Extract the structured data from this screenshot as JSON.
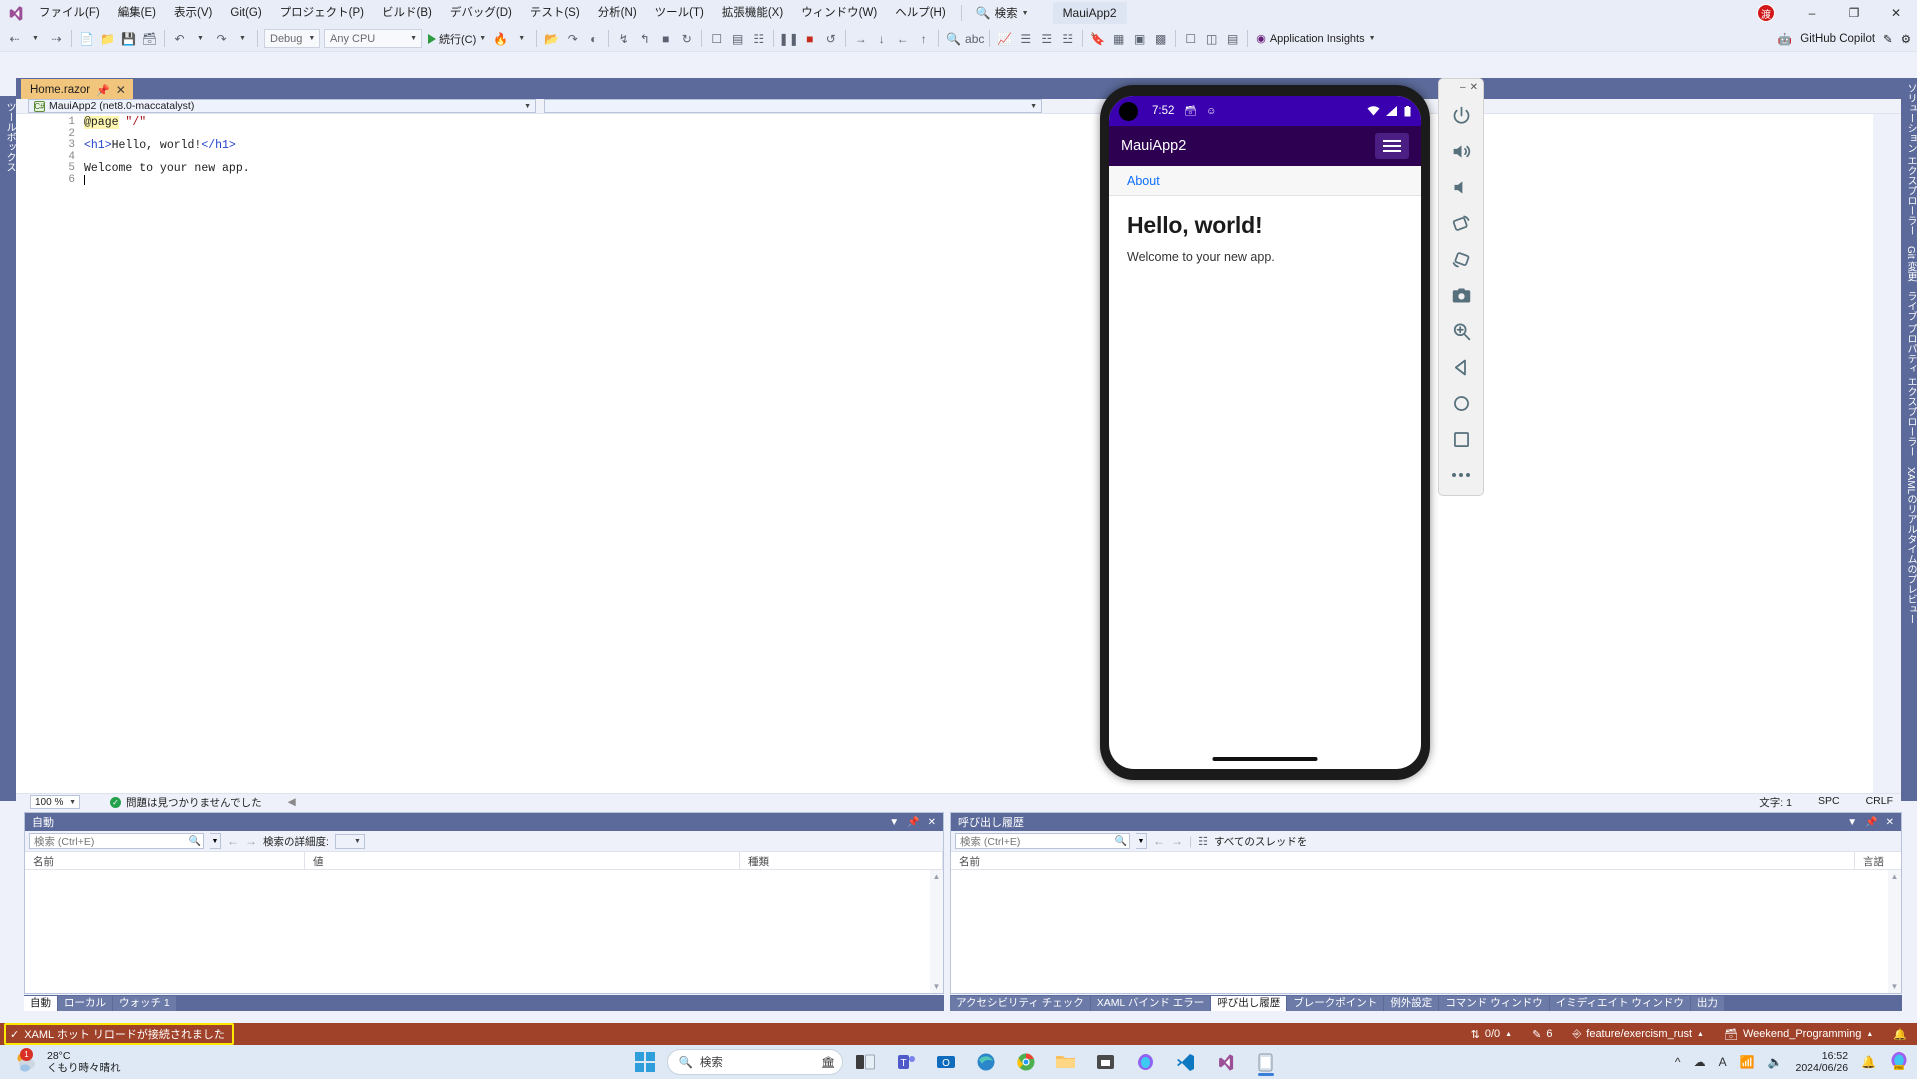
{
  "titlebar": {
    "menus": [
      "ファイル(F)",
      "編集(E)",
      "表示(V)",
      "Git(G)",
      "プロジェクト(P)",
      "ビルド(B)",
      "デバッグ(D)",
      "テスト(S)",
      "分析(N)",
      "ツール(T)",
      "拡張機能(X)",
      "ウィンドウ(W)",
      "ヘルプ(H)"
    ],
    "search_label": "検索",
    "project_name": "MauiApp2",
    "avatar_initial": "渡",
    "minimize": "–",
    "restore": "❐",
    "close": "✕"
  },
  "toolbar": {
    "config_label": "Debug",
    "platform_label": "Any CPU",
    "run_label": "続行(C)",
    "app_insights_label": "Application Insights",
    "copilot_label": "GitHub Copilot"
  },
  "left_strip": {
    "tabs": [
      "ツールボックス"
    ]
  },
  "doc_tab": {
    "title": "Home.razor",
    "pin_icon": "pin-icon",
    "close_icon": "close-icon"
  },
  "navbar": {
    "project_scope": "MauiApp2 (net8.0-maccatalyst)",
    "member_scope": ""
  },
  "editor": {
    "line_numbers": [
      "1",
      "2",
      "3",
      "4",
      "5",
      "6"
    ],
    "lines": [
      {
        "parts": [
          {
            "t": "@page",
            "c": "tok-dir"
          },
          {
            "t": " ",
            "c": ""
          },
          {
            "t": "\"/\"",
            "c": "tok-str"
          }
        ]
      },
      {
        "parts": []
      },
      {
        "parts": [
          {
            "t": "<h1>",
            "c": "tok-brk"
          },
          {
            "t": "Hello, world!",
            "c": ""
          },
          {
            "t": "</h1>",
            "c": "tok-brk"
          }
        ]
      },
      {
        "parts": []
      },
      {
        "parts": [
          {
            "t": "Welcome to your new app.",
            "c": ""
          }
        ]
      },
      {
        "parts": []
      }
    ]
  },
  "editor_status": {
    "zoom": "100 %",
    "problems": "問題は見つかりませんでした",
    "chars": "文字: 1",
    "spaces": "SPC",
    "eol": "CRLF"
  },
  "right_strip": {
    "tabs": [
      "ソリューション エクスプローラー",
      "Git 変更",
      "ライブ プロパティ エクスプローラー",
      "XAMLのリアルタイムのプレビュー"
    ]
  },
  "autos_panel": {
    "title": "自動",
    "search_placeholder": "検索 (Ctrl+E)",
    "depth_label": "検索の詳細度:",
    "depth_value": "",
    "columns": [
      "名前",
      "値",
      "種類"
    ],
    "rows": []
  },
  "callstack_panel": {
    "title": "呼び出し履歴",
    "search_placeholder": "検索 (Ctrl+E)",
    "threads_label": "すべてのスレッドを",
    "columns": [
      "名前",
      "言語"
    ],
    "rows": []
  },
  "bottom_tabs_left": {
    "tabs": [
      {
        "label": "自動",
        "active": true
      },
      {
        "label": "ローカル",
        "active": false
      },
      {
        "label": "ウォッチ 1",
        "active": false
      }
    ]
  },
  "bottom_tabs_right": {
    "tabs": [
      {
        "label": "アクセシビリティ チェック",
        "active": false
      },
      {
        "label": "XAML バインド エラー",
        "active": false
      },
      {
        "label": "呼び出し履歴",
        "active": true
      },
      {
        "label": "ブレークポイント",
        "active": false
      },
      {
        "label": "例外設定",
        "active": false
      },
      {
        "label": "コマンド ウィンドウ",
        "active": false
      },
      {
        "label": "イミディエイト ウィンドウ",
        "active": false
      },
      {
        "label": "出力",
        "active": false
      }
    ]
  },
  "vs_status": {
    "hot_reload": "XAML ホット リロードが接続されました",
    "sync": "0/0",
    "pending_changes": "6",
    "branch": "feature/exercism_rust",
    "repository": "Weekend_Programming",
    "highlight_color": "#ffe800",
    "bar_color": "#a0422a"
  },
  "emulator": {
    "status_time": "7:52",
    "app_title": "MauiApp2",
    "nav_link": "About",
    "heading": "Hello, world!",
    "body_text": "Welcome to your new app.",
    "status_bar_color": "#3a00b0",
    "app_bar_color": "#2d0052",
    "tools": [
      {
        "name": "power-icon"
      },
      {
        "name": "volume-up-icon"
      },
      {
        "name": "volume-down-icon"
      },
      {
        "name": "rotate-left-icon"
      },
      {
        "name": "rotate-right-icon"
      },
      {
        "name": "camera-icon"
      },
      {
        "name": "zoom-icon"
      },
      {
        "name": "back-icon"
      },
      {
        "name": "home-icon"
      },
      {
        "name": "overview-icon"
      },
      {
        "name": "more-icon"
      }
    ],
    "minimize": "–",
    "close": "✕"
  },
  "taskbar": {
    "weather_temp": "28°C",
    "weather_desc": "くもり時々晴れ",
    "weather_badge": "1",
    "search_placeholder": "検索",
    "clock_time": "16:52",
    "clock_date": "2024/06/26"
  }
}
